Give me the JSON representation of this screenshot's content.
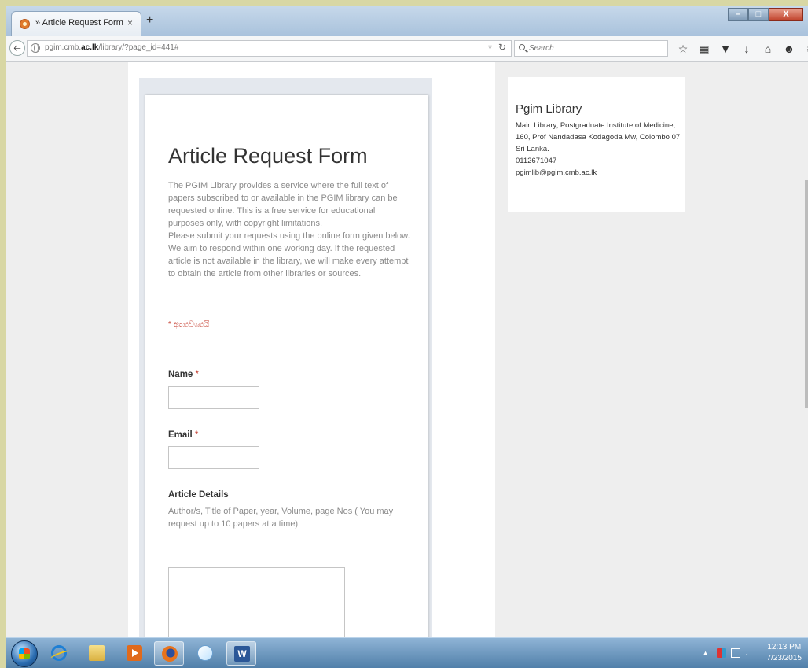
{
  "window": {
    "tab_title": "» Article Request Form",
    "tab_close": "×",
    "new_tab": "+",
    "minimize": "–",
    "maximize": "□",
    "close": "X"
  },
  "navbar": {
    "url_prefix": "pgim.cmb.",
    "url_domain": "ac.lk",
    "url_path": "/library/?page_id=441#",
    "search_placeholder": "Search",
    "icons": [
      "bookmark-star-icon",
      "reading-list-icon",
      "pocket-icon",
      "download-icon",
      "home-icon",
      "chat-icon",
      "menu-icon"
    ]
  },
  "form": {
    "title": "Article Request Form",
    "description": "The PGIM Library provides a service where the full text of papers subscribed to or available in the PGIM library can be requested online. This is a free service for educational purposes only, with copyright limitations.",
    "instructions": "Please submit your requests using the online form given below. We aim to respond within one working day. If the requested article is not available in the library, we will make every attempt to obtain the article from other libraries or sources.",
    "required_note": "* අත්‍යවශ්‍යයි",
    "required_marker": "*",
    "fields": {
      "name_label": "Name",
      "email_label": "Email",
      "article_label": "Article Details",
      "article_help": "Author/s, Title of Paper, year, Volume, page Nos ( You may request up to 10 papers at a time)"
    }
  },
  "sidebar": {
    "title": "Pgim Library",
    "address_line1": "Main Library, Postgraduate Institute of Medicine,",
    "address_line2": "160, Prof Nandadasa Kodagoda Mw, Colombo 07,",
    "address_line3": "Sri Lanka.",
    "phone": "0112671047",
    "email": "pgimlib@pgim.cmb.ac.lk"
  },
  "taskbar": {
    "apps": [
      "internet-explorer",
      "file-explorer",
      "media-player",
      "firefox",
      "paint",
      "word"
    ],
    "word_letter": "W",
    "clock_time": "12:13 PM",
    "clock_date": "7/23/2015"
  },
  "colors": {
    "required": "#c43b2d",
    "desktop_border": "#d8d7a4"
  }
}
